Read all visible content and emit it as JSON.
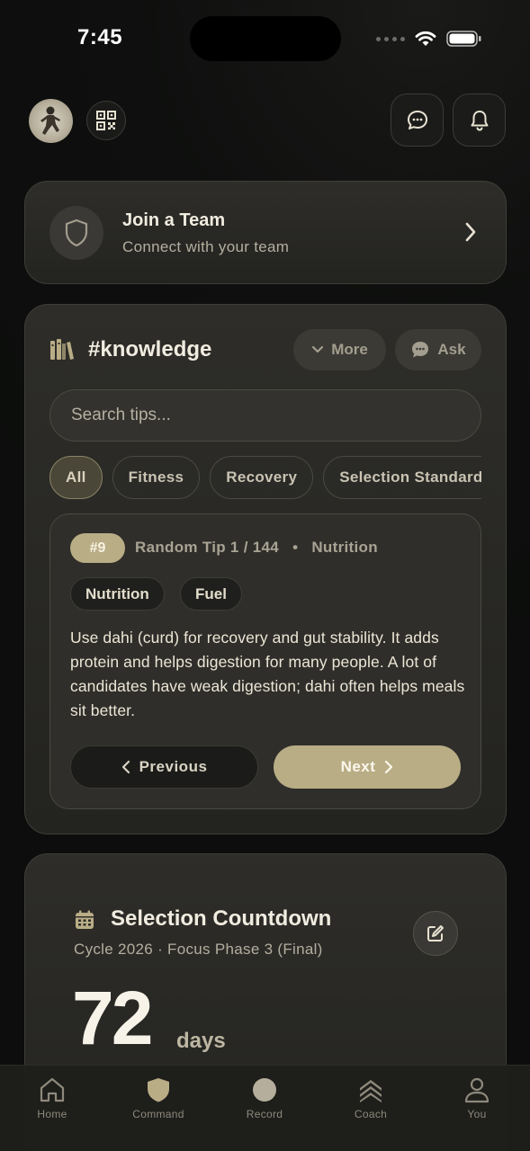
{
  "status_bar": {
    "time": "7:45"
  },
  "header": {
    "icons": [
      "avatar",
      "qr-code-icon",
      "chat-icon",
      "bell-icon"
    ]
  },
  "team_card": {
    "title": "Join a Team",
    "subtitle": "Connect with your team"
  },
  "knowledge": {
    "title": "#knowledge",
    "more_label": "More",
    "ask_label": "Ask",
    "search_placeholder": "Search tips...",
    "categories": [
      {
        "label": "All",
        "active": true
      },
      {
        "label": "Fitness",
        "active": false
      },
      {
        "label": "Recovery",
        "active": false
      },
      {
        "label": "Selection Standards",
        "active": false
      }
    ],
    "tip": {
      "number": "#9",
      "meta": "Random Tip 1 / 144",
      "separator": "•",
      "category": "Nutrition",
      "tags": [
        "Nutrition",
        "Fuel"
      ],
      "body": "Use dahi (curd) for recovery and gut stability. It adds protein and helps digestion for many people. A lot of candidates have weak digestion; dahi often helps meals sit better.",
      "previous_label": "Previous",
      "next_label": "Next"
    }
  },
  "countdown": {
    "title": "Selection Countdown",
    "subtitle": "Cycle 2026 · Focus Phase 3 (Final)",
    "days_value": "72",
    "days_unit": "days"
  },
  "tabbar": {
    "items": [
      {
        "label": "Home",
        "icon": "home-icon"
      },
      {
        "label": "Command",
        "icon": "shield-icon"
      },
      {
        "label": "Record",
        "icon": "record-icon"
      },
      {
        "label": "Coach",
        "icon": "chevrons-up-icon"
      },
      {
        "label": "You",
        "icon": "user-icon"
      }
    ]
  },
  "colors": {
    "accent": "#b9ad86",
    "background": "#0e0f0e",
    "card": "#2a2a26"
  }
}
